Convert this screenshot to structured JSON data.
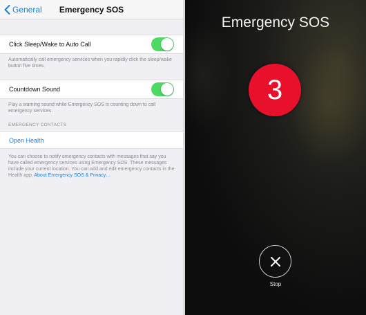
{
  "navbar": {
    "back_label": "General",
    "title": "Emergency SOS"
  },
  "settings": {
    "auto_call": {
      "label": "Click Sleep/Wake to Auto Call",
      "enabled": true,
      "footnote": "Automatically call emergency services when you rapidly click the sleep/wake button five times."
    },
    "countdown_sound": {
      "label": "Countdown Sound",
      "enabled": true,
      "footnote": "Play a warning sound while Emergency SOS is counting down to call emergency services."
    },
    "contacts_header": "EMERGENCY CONTACTS",
    "open_health": "Open Health",
    "contacts_footnote": "You can choose to notify emergency contacts with messages that say you have called emergency services using Emergency SOS. These messages include your current location. You can add and edit emergency contacts in the Health app.",
    "contacts_footnote_link": "About Emergency SOS & Privacy…"
  },
  "sos_screen": {
    "title": "Emergency SOS",
    "countdown": "3",
    "stop_label": "Stop"
  },
  "colors": {
    "toggle_on": "#4cd964",
    "link": "#1a7fe0",
    "countdown_red": "#e8102a"
  },
  "icons": {
    "back": "chevron-left-icon",
    "stop": "close-icon"
  }
}
